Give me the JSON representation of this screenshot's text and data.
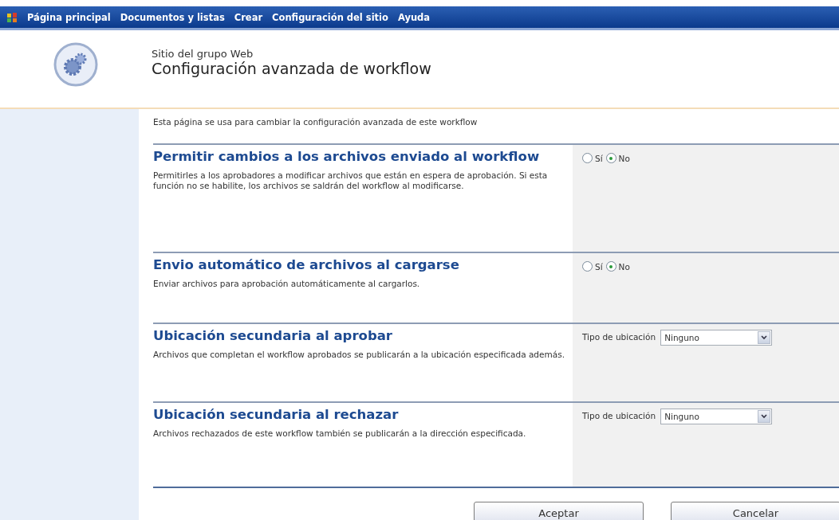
{
  "nav": {
    "items": [
      "Página principal",
      "Documentos y listas",
      "Crear",
      "Configuración del sitio",
      "Ayuda"
    ]
  },
  "header": {
    "site": "Sitio del grupo Web",
    "title": "Configuración avanzada de workflow"
  },
  "intro": "Esta página se usa para cambiar la configuración avanzada de este workflow",
  "sections": [
    {
      "kind": "radio",
      "title": "Permitir cambios a los archivos enviado al workflow",
      "description": "Permitirles a los aprobadores a modificar archivos que están en espera de aprobación. Si esta función no se habilite, los archivos se saldrán del workflow al modificarse.",
      "options": [
        {
          "label": "Sí",
          "selected": false
        },
        {
          "label": "No",
          "selected": true
        }
      ]
    },
    {
      "kind": "radio",
      "title": "Envio automático de archivos al cargarse",
      "description": "Enviar archivos para aprobación automáticamente al cargarlos.",
      "options": [
        {
          "label": "Sí",
          "selected": false
        },
        {
          "label": "No",
          "selected": true
        }
      ]
    },
    {
      "kind": "select",
      "title": "Ubicación secundaria al aprobar",
      "description": "Archivos que completan el workflow aprobados se publicarán a la ubicación especificada además.",
      "label": "Tipo de ubicación",
      "value": "Ninguno"
    },
    {
      "kind": "select",
      "title": "Ubicación secundaria al rechazar",
      "description": "Archivos rechazados de este workflow también se publicarán a la dirección especificada.",
      "label": "Tipo de ubicación",
      "value": "Ninguno"
    }
  ],
  "buttons": [
    "Aceptar",
    "Cancelar"
  ]
}
